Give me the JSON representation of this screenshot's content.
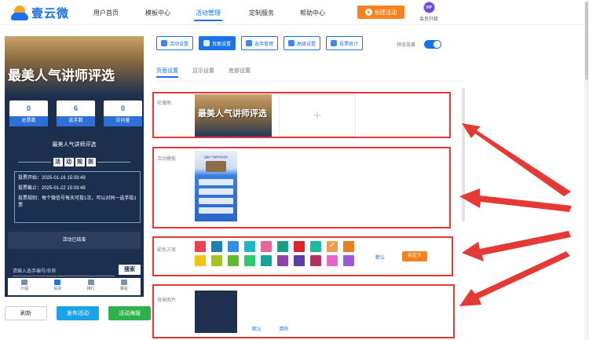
{
  "brand": {
    "name": "壹云微"
  },
  "nav": {
    "items": [
      "用户首页",
      "模板中心",
      "活动管理",
      "定制服务",
      "帮助中心"
    ],
    "active_index": 2
  },
  "header": {
    "create_label": "创建活动",
    "vip_badge": "VIP",
    "vip_label": "会员升级"
  },
  "preview": {
    "banner_title": "最美人气讲师评选",
    "stats": [
      {
        "value": "0",
        "label": "总票数"
      },
      {
        "value": "6",
        "label": "选手数"
      },
      {
        "value": "0",
        "label": "访问量"
      }
    ],
    "activity_name": "最美人气讲师评选",
    "rules_chars": [
      "活",
      "动",
      "规",
      "则"
    ],
    "rules": [
      "投票开始：2025-01-16 15:03:49",
      "投票截止：2025-01-22 15:03:49",
      "投票规则：每个微信号每天可投1次，可以对同一选手投1票"
    ],
    "end_text": "活动已结束",
    "search_placeholder": "请输入选手编号/名称",
    "search_label": "搜索",
    "tabs": [
      {
        "label": "介绍",
        "icon": "home-icon"
      },
      {
        "label": "投票",
        "icon": "flag-icon"
      },
      {
        "label": "排行",
        "icon": "chart-icon"
      },
      {
        "label": "报名",
        "icon": "signup-icon"
      }
    ],
    "active_tab": 1
  },
  "actions": {
    "refresh": "刷新",
    "publish": "发布活动",
    "poster": "活动海报"
  },
  "toolbar": {
    "buttons": [
      "活动设置",
      "页面设置",
      "选手管理",
      "高级设置",
      "投票统计"
    ],
    "active_index": 1,
    "preview_label": "预览效果",
    "preview_on": true
  },
  "subtabs": {
    "items": [
      "页面设置",
      "显示设置",
      "底部设置"
    ],
    "active_index": 0
  },
  "sections": {
    "carousel_label": "轮播图",
    "carousel_image_title": "最美人气讲师评选",
    "template_label": "活动模板",
    "template_thumb_title": "最美人气讲师评选活动",
    "color_label": "配色方案",
    "color_default": "默认",
    "color_custom": "自定义",
    "bg_label": "背景图片",
    "bg_default": "默认",
    "bg_clear": "清除"
  },
  "colors": {
    "swatches": [
      "#e8434f",
      "#1f7fb5",
      "#2f8fe8",
      "#1cb5c9",
      "#e6669b",
      "#16a085",
      "#d9262c",
      "#1bbc9b",
      "#f39c4a",
      "#e67e22",
      "#f1c40f",
      "#a7c520",
      "#5dbb2c",
      "#2ecc71",
      "#16a79a",
      "#8e44ad",
      "#5b3fa8",
      "#b5305e",
      "#e667c8",
      "#9b59d9"
    ],
    "selected_index": 8,
    "accent": "#1a73e8",
    "annotation": "#e53935"
  }
}
